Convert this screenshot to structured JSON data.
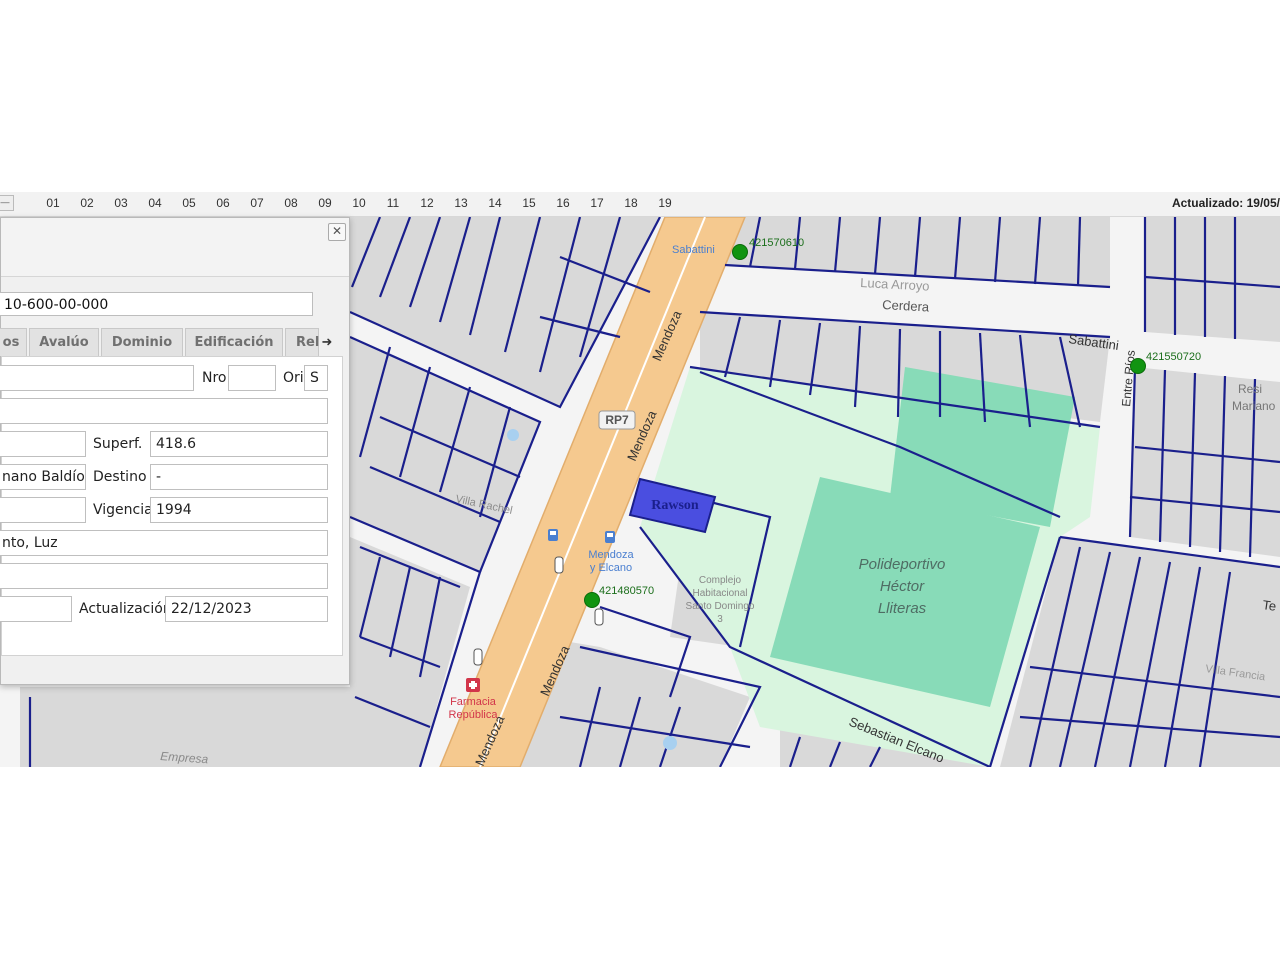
{
  "toolbar": {
    "button_icon": "minus-icon",
    "months": [
      "01",
      "02",
      "03",
      "04",
      "05",
      "06",
      "07",
      "08",
      "09",
      "10",
      "11",
      "12",
      "13",
      "14",
      "15",
      "16",
      "17",
      "18",
      "19"
    ],
    "updated_label": "Actualizado: 19/05/"
  },
  "panel": {
    "close_glyph": "✕",
    "parcel_id": "10-600-00-000",
    "tabs": [
      "os",
      "Avalúo",
      "Dominio",
      "Edificación",
      "Rel"
    ],
    "tab_arrow_icon": "arrow-right-icon",
    "fields": {
      "street_value": "",
      "nro_label": "Nro",
      "nro_value": "",
      "ori_label": "Ori",
      "ori_value": "S",
      "row2_value": "",
      "row3_left_value": "",
      "superf_label": "Superf.",
      "superf_value": "418.6",
      "row4_left_value": "nano Baldío",
      "destino_label": "Destino",
      "destino_value": "-",
      "row5_left_value": "",
      "vigencia_label": "Vigencia",
      "vigencia_value": "1994",
      "services_value": "nto, Luz",
      "row7_value": "",
      "row8_left_value": "",
      "actualizacion_label": "Actualización",
      "actualizacion_value": "22/12/2023"
    }
  },
  "map": {
    "streets": {
      "mendoza": "Mendoza",
      "route": "RP7",
      "cerdera": "Cerdera",
      "luca_arroyo": "Luca Arroyo",
      "sabattini": "Sabattini",
      "sabattini_top": "Sabattini",
      "entre_rios": "Entre Ríos",
      "sebastian_elcano": "Sebastian Elcano",
      "te": "Te",
      "resi": "Resi",
      "mariano": "Mariano"
    },
    "poi": {
      "park_line1": "Polideportivo",
      "park_line2": "Héctor",
      "park_line3": "Lliteras",
      "parcel_label": "Rawson",
      "villa_rachel": "Villa Rachel",
      "complex_line1": "Complejo",
      "complex_line2": "Habitacional",
      "complex_line3": "Santo Domingo",
      "complex_line4": "3",
      "bus_stop_line1": "Mendoza",
      "bus_stop_line2": "y Elcano",
      "pharmacy_line1": "Farmacia",
      "pharmacy_line2": "República",
      "empresa": "Empresa",
      "villa_francia": "Villa Francia"
    },
    "markers": [
      "421570610",
      "421550720",
      "421480570"
    ],
    "colors": {
      "parcel_line": "#1a1f8c",
      "block_fill": "#d9d9d9",
      "street_fill": "#f4f4f4",
      "avenue_fill": "#f5c98f",
      "park_fill": "#d9f5df",
      "field_fill": "#88dbb8",
      "selected_parcel": "#4a4ee0",
      "marker": "#119411"
    }
  }
}
